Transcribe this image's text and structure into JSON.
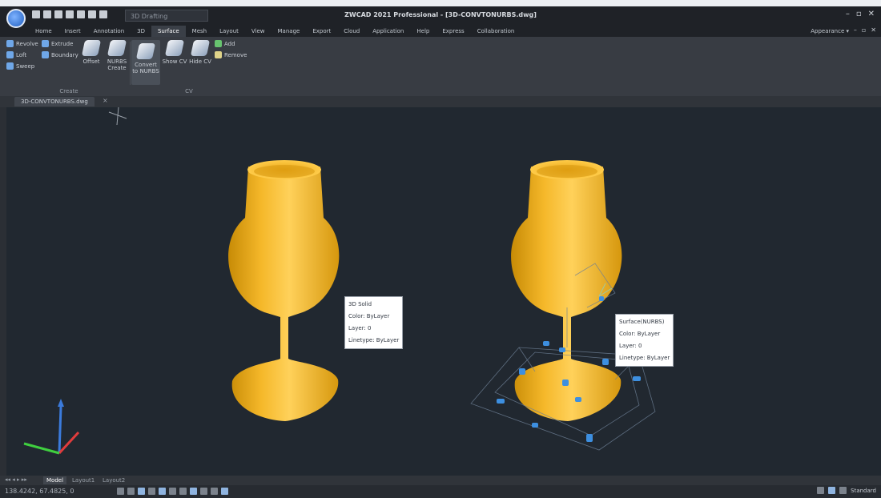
{
  "window": {
    "title": "ZWCAD 2021 Professional - [3D-CONVTONURBS.dwg]",
    "workspace": "3D Drafting"
  },
  "menu_tabs": [
    "Home",
    "Insert",
    "Annotation",
    "3D",
    "Surface",
    "Mesh",
    "Layout",
    "View",
    "Manage",
    "Export",
    "Cloud",
    "Application",
    "Help",
    "Express",
    "Collaboration"
  ],
  "active_tab": "Surface",
  "appearance_label": "Appearance",
  "ribbon": {
    "create_small": [
      "Revolve",
      "Loft",
      "Sweep"
    ],
    "create_small2": [
      "Extrude",
      "Boundary"
    ],
    "create_big": [
      "Offset",
      "NURBS Create"
    ],
    "edit_big": [
      "Convert to NURBS",
      "Show CV",
      "Hide CV"
    ],
    "edit_small": [
      "Add",
      "Remove"
    ],
    "create_label": "Create",
    "cv_label": "CV"
  },
  "doc_tab": "3D-CONVTONURBS.dwg",
  "tooltips": {
    "solid": [
      "3D Solid",
      "Color: ByLayer",
      "Layer: 0",
      "Linetype: ByLayer"
    ],
    "surface": [
      "Surface(NURBS)",
      "Color: ByLayer",
      "Layer: 0",
      "Linetype: ByLayer"
    ]
  },
  "layout_tabs": [
    "Model",
    "Layout1",
    "Layout2"
  ],
  "status": {
    "coords": "138.4242, 67.4825, 0",
    "right_label": "Standard"
  },
  "colors": {
    "glass": "#f2b21a",
    "viewport_bg": "#212830",
    "cv_grip": "#3d8fe0",
    "axis_x": "#e03c3c",
    "axis_y": "#3fcf3f",
    "axis_z": "#3b7bdc"
  }
}
